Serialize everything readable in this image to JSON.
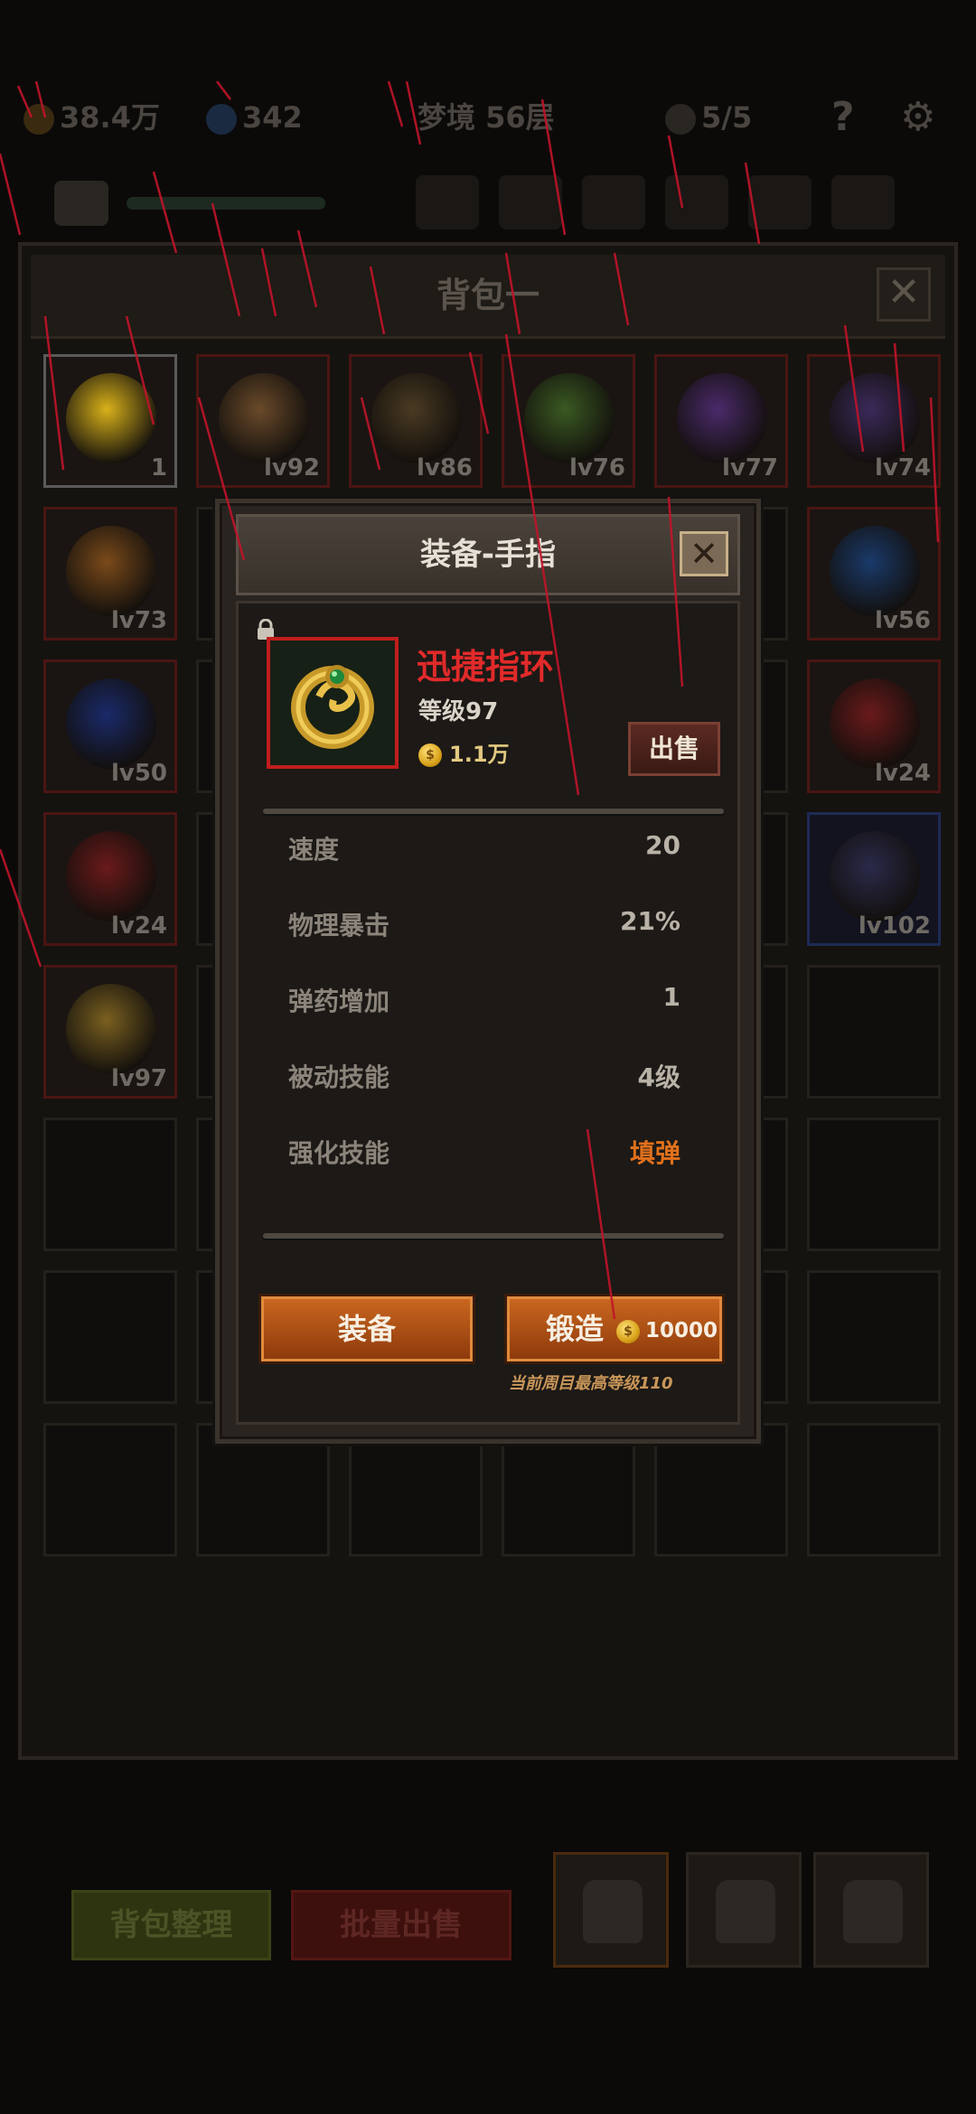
{
  "hud": {
    "gold": "38.4万",
    "gems": "342",
    "stage": "梦境 56层",
    "skulls": "5/5",
    "help_icon": "question-icon",
    "settings_icon": "gear-icon"
  },
  "bag": {
    "title": "背包一",
    "close_icon": "close-icon",
    "cells": [
      {
        "level": "1",
        "kind": "cheese",
        "color": "#d9b21a"
      },
      {
        "level": "lv92",
        "kind": "mace",
        "color": "#6a4a2a"
      },
      {
        "level": "lv86",
        "kind": "staff",
        "color": "#4a3a22"
      },
      {
        "level": "lv76",
        "kind": "gun",
        "color": "#3a5a22"
      },
      {
        "level": "lv77",
        "kind": "hood",
        "color": "#4a2a6a"
      },
      {
        "level": "lv74",
        "kind": "hood",
        "color": "#3a2a5a"
      },
      {
        "level": "lv73",
        "kind": "helmet",
        "color": "#7a4a1a"
      },
      {
        "level": "lv56",
        "kind": "ring",
        "color": "#1a3a6a"
      },
      {
        "level": "lv50",
        "kind": "orb",
        "color": "#1a2a6a"
      },
      {
        "level": "lv24",
        "kind": "amulet",
        "color": "#6a1a1a"
      },
      {
        "level": "lv24",
        "kind": "amulet",
        "color": "#6a1a1a"
      },
      {
        "level": "lv102",
        "kind": "armor",
        "color": "#2a2a4a"
      },
      {
        "level": "lv97",
        "kind": "ring",
        "color": "#7a6020"
      }
    ],
    "sort_button": "背包整理",
    "bulk_sell_button": "批量出售"
  },
  "modal": {
    "title": "装备-手指",
    "close_icon": "close-icon",
    "lock_icon": "lock-icon",
    "item_name": "迅捷指环",
    "item_level": "等级97",
    "price": "1.1万",
    "sell_button": "出售",
    "stats": [
      {
        "key": "速度",
        "value": "20",
        "highlight": false
      },
      {
        "key": "物理暴击",
        "value": "21%",
        "highlight": false
      },
      {
        "key": "弹药增加",
        "value": "1",
        "highlight": false
      },
      {
        "key": "被动技能",
        "value": "4级",
        "highlight": false
      },
      {
        "key": "强化技能",
        "value": "填弹",
        "highlight": true
      }
    ],
    "equip_button": "装备",
    "forge_button": "锻造",
    "forge_cost": "10000",
    "max_level_note": "当前周目最高等级110"
  },
  "colors": {
    "item_name": "#e12a2a",
    "highlight_value": "#e0701c",
    "button_orange": "#c9661f"
  }
}
